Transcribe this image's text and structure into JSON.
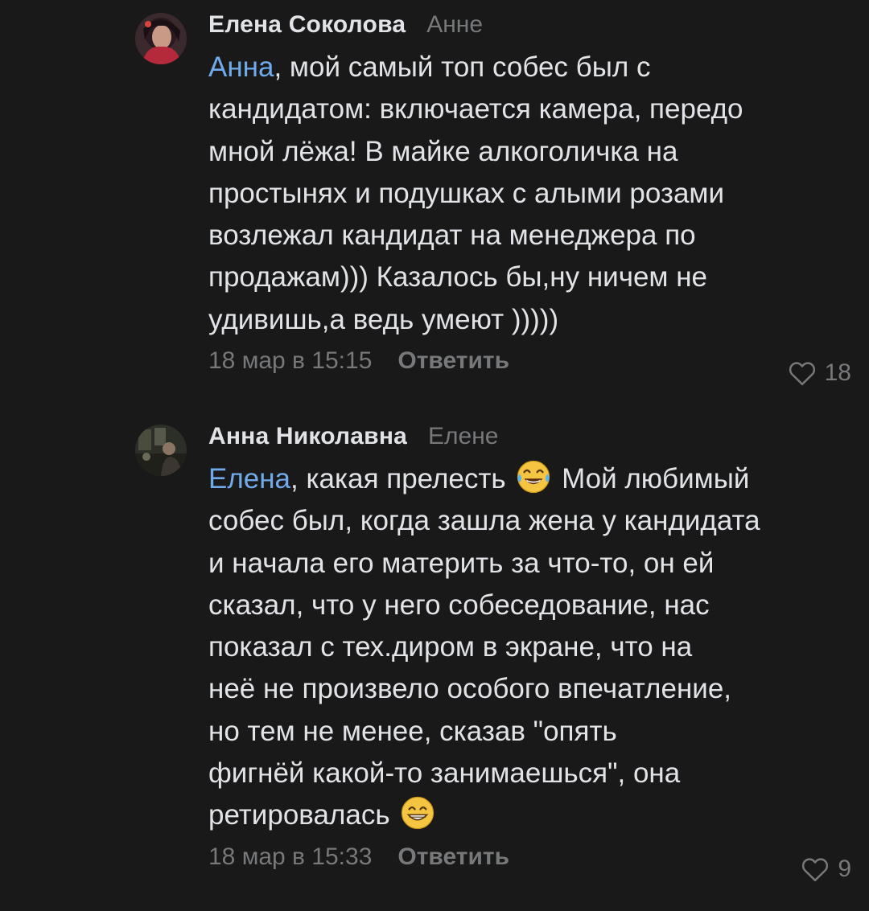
{
  "comments": [
    {
      "author": "Елена Соколова",
      "reply_to": "Анне",
      "mention": "Анна",
      "lines": [
        ", мой самый топ собес был с",
        "кандидатом: включается камера, передо",
        "мной лёжа! В майке алкоголичка на",
        "простынях и подушках с алыми розами",
        "возлежал кандидат на менеджера по",
        "продажам))) Казалось бы,ну ничем не",
        "удивишь,а ведь умеют )))))"
      ],
      "time": "18 мар в 15:15",
      "reply_label": "Ответить",
      "likes": "18"
    },
    {
      "author": "Анна Николавна",
      "reply_to": "Елене",
      "mention": "Елена",
      "first_line_before_emoji": ", какая прелесть",
      "first_line_emoji": "joy-emoji",
      "first_line_after_emoji": "Мой любимый",
      "lines": [
        "собес был, когда зашла жена у кандидата",
        "и начала его материть за что-то, он ей",
        "сказал, что у него собеседование, нас",
        "показал с тех.диром в экране, что на",
        "неё не произвело особого впечатление,",
        "но тем не менее, сказав \"опять",
        "фигнёй какой-то занимаешься\", она"
      ],
      "last_line": "ретировалась",
      "last_line_emoji": "grin-emoji",
      "time": "18 мар в 15:33",
      "reply_label": "Ответить",
      "likes": "9"
    }
  ],
  "colors": {
    "background": "#19191a",
    "text": "#e1e3e6",
    "secondary": "#76787a",
    "mention": "#71aaeb"
  }
}
